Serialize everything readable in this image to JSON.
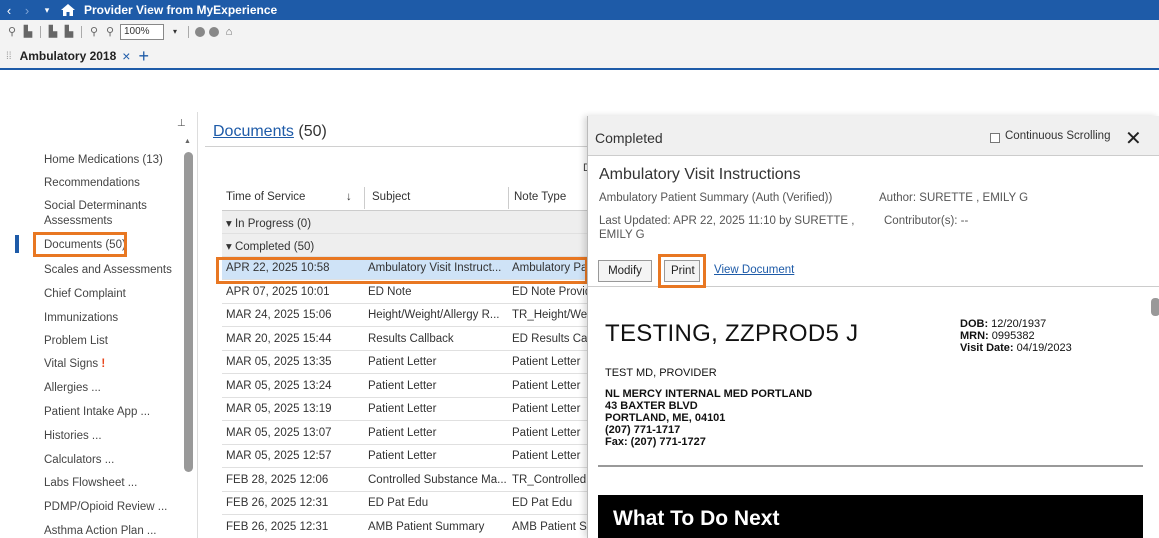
{
  "titlebar": {
    "back": "‹",
    "forward": "›",
    "dropdown": "▾",
    "title": "Provider View from MyExperience"
  },
  "toolbar": {
    "zoom": "100%",
    "zoom_dd": "▾"
  },
  "tabs": {
    "grip": "⁞⁞",
    "active": "Ambulatory 2018",
    "close": "×",
    "add": "+"
  },
  "leftnav": {
    "items": [
      "Home Medications (13)",
      "Recommendations",
      "Social Determinants",
      "Assessments",
      "Documents (50)",
      "Scales and Assessments",
      "Chief Complaint",
      "Immunizations",
      "Problem List",
      "Vital Signs",
      "Allergies ...",
      "Patient Intake App ...",
      "Histories ...",
      "Calculators ...",
      "Labs Flowsheet ...",
      "PDMP/Opioid Review ...",
      "Asthma Action Plan ..."
    ],
    "flag": "!"
  },
  "documents": {
    "title_link": "Documents",
    "count": "(50)",
    "col_header_d": "D",
    "columns": [
      "Time of Service",
      "Subject",
      "Note Type"
    ],
    "sort_icon": "↓",
    "groups": {
      "in_progress": "▾  In Progress (0)",
      "completed": "▾  Completed (50)"
    },
    "rows": [
      [
        "APR 22, 2025 10:58",
        "Ambulatory Visit Instruct...",
        "Ambulatory Pa"
      ],
      [
        "APR 07, 2025 10:01",
        "ED Note",
        "ED Note Provid"
      ],
      [
        "MAR 24, 2025 15:06",
        "Height/Weight/Allergy R...",
        "TR_Height/Wei"
      ],
      [
        "MAR 20, 2025 15:44",
        "Results Callback",
        "ED Results Call"
      ],
      [
        "MAR 05, 2025 13:35",
        "Patient Letter",
        "Patient Letter"
      ],
      [
        "MAR 05, 2025 13:24",
        "Patient Letter",
        "Patient Letter"
      ],
      [
        "MAR 05, 2025 13:19",
        "Patient Letter",
        "Patient Letter"
      ],
      [
        "MAR 05, 2025 13:07",
        "Patient Letter",
        "Patient Letter"
      ],
      [
        "MAR 05, 2025 12:57",
        "Patient Letter",
        "Patient Letter"
      ],
      [
        "FEB 28, 2025 12:06",
        "Controlled Substance Ma...",
        "TR_Controlled"
      ],
      [
        "FEB 26, 2025 12:31",
        "ED Pat Edu",
        "ED Pat Edu"
      ],
      [
        "FEB 26, 2025 12:31",
        "AMB Patient Summary",
        "AMB Patient Su"
      ]
    ]
  },
  "panel": {
    "status": "Completed",
    "continuous_scrolling": "Continuous Scrolling",
    "close": "✕",
    "doc_title": "Ambulatory Visit Instructions",
    "doc_type": "Ambulatory Patient Summary (Auth (Verified))",
    "author": "Author: SURETTE , EMILY G",
    "last_updated": "Last Updated: APR 22, 2025 11:10 by SURETTE ,",
    "last_updated_2": "EMILY G",
    "contributors": "Contributor(s): --",
    "modify": "Modify",
    "print": "Print",
    "view_document": "View Document"
  },
  "document": {
    "patient_name": "TESTING, ZZPROD5 J",
    "dob_label": "DOB:",
    "dob": "12/20/1937",
    "mrn_label": "MRN:",
    "mrn": "0995382",
    "visit_label": "Visit Date:",
    "visit": "04/19/2023",
    "provider": "TEST MD, PROVIDER",
    "address": [
      "NL MERCY INTERNAL MED PORTLAND",
      "43 BAXTER BLVD",
      "PORTLAND, ME, 04101",
      "(207) 771-1717",
      "Fax: (207) 771-1727"
    ],
    "section_heading": "What To Do Next"
  },
  "colors": {
    "brand_blue": "#1e5ba8",
    "highlight_orange": "#e87722",
    "selected_row": "#cfe3f7"
  }
}
